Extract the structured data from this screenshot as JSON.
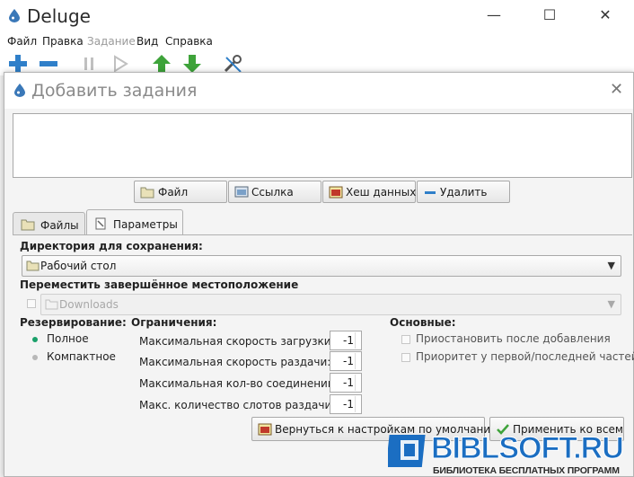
{
  "app": {
    "title": "Deluge",
    "window_controls": {
      "minimize": "—",
      "maximize": "☐",
      "close": "✕"
    }
  },
  "menu": [
    {
      "label": "Файл",
      "enabled": true
    },
    {
      "label": "Правка",
      "enabled": true
    },
    {
      "label": "Задание",
      "enabled": false
    },
    {
      "label": "Вид",
      "enabled": true
    },
    {
      "label": "Справка",
      "enabled": true
    }
  ],
  "toolbar": {
    "icons": [
      "add-torrent-icon",
      "remove-torrent-icon",
      "pause-icon",
      "resume-icon",
      "queue-up-icon",
      "queue-down-icon",
      "preferences-icon"
    ]
  },
  "dialog": {
    "title": "Добавить задания",
    "close_glyph": "✕",
    "add_buttons": {
      "file": "Файл",
      "url": "Ссылка",
      "infohash": "Хеш данных",
      "remove": "Удалить"
    },
    "tabs": [
      {
        "label": "Файлы",
        "active": false
      },
      {
        "label": "Параметры",
        "active": true
      }
    ],
    "options": {
      "download_location_label": "Директория для сохранения:",
      "download_location_value": "Рабочий стол",
      "move_completed_label": "Переместить завершённое местоположение",
      "move_completed_value": "Downloads",
      "allocation": {
        "heading": "Резервирование:",
        "full": "Полное",
        "compact": "Компактное",
        "selected": "full"
      },
      "bandwidth": {
        "heading": "Ограничения:",
        "max_download_label": "Максимальная скорость загрузки:",
        "max_download_value": "-1",
        "max_upload_label": "Максимальная скорость раздачи:",
        "max_upload_value": "-1",
        "max_connections_label": "Максимальная кол-во соединений:",
        "max_connections_value": "-1",
        "max_upload_slots_label": "Макс. количество слотов раздачи:",
        "max_upload_slots_value": "-1"
      },
      "general": {
        "heading": "Основные:",
        "add_paused": "Приостановить после добавления",
        "prioritize_first_last": "Приоритет у первой/последней частей"
      },
      "revert_button": "Вернуться к настройкам по умолчанию",
      "apply_all_button": "Применить ко всем"
    }
  },
  "watermark": {
    "title": "BIBLSOFT.RU",
    "subtitle": "БИБЛИОТЕКА БЕСПЛАТНЫХ ПРОГРАММ"
  },
  "colors": {
    "radio_selected": "#1aa06a",
    "radio_unselected": "#b8b8b8",
    "accent_blue": "#1b6ec2",
    "toolbar_plus": "#2f7fc9",
    "arrow_green": "#3ea33a"
  }
}
